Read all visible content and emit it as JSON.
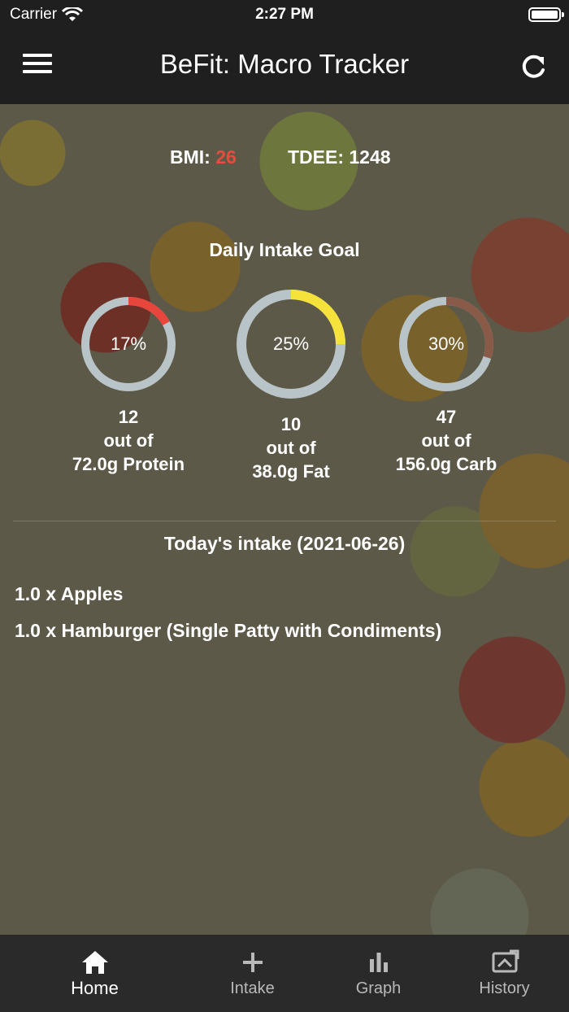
{
  "status_bar": {
    "carrier": "Carrier",
    "time": "2:27 PM"
  },
  "nav": {
    "title": "BeFit: Macro Tracker",
    "menu_icon": "hamburger-menu-icon",
    "refresh_icon": "refresh-icon"
  },
  "stats": {
    "bmi_label": "BMI:",
    "bmi_value": "26",
    "tdee_label": "TDEE: 1248",
    "bmi_color": "#e74c3c"
  },
  "goal": {
    "title": "Daily Intake Goal",
    "rings": [
      {
        "percent_text": "17%",
        "fraction": 0.17,
        "color": "#e8453c",
        "consumed": "12",
        "out_of": "out of",
        "target": "72.0g Protein"
      },
      {
        "percent_text": "25%",
        "fraction": 0.25,
        "color": "#f5e23a",
        "consumed": "10",
        "out_of": "out of",
        "target": "38.0g Fat"
      },
      {
        "percent_text": "30%",
        "fraction": 0.3,
        "color": "#8a5a48",
        "consumed": "47",
        "out_of": "out of",
        "target": "156.0g Carb"
      }
    ],
    "track_color": "#b8c4c8"
  },
  "intake": {
    "title": "Today's intake (2021-06-26)",
    "items": [
      "1.0 x Apples",
      "1.0 x Hamburger (Single Patty with Condiments)"
    ]
  },
  "tabbar": {
    "tabs": [
      {
        "label": "Home",
        "icon": "home-icon",
        "active": true
      },
      {
        "label": "Intake",
        "icon": "plus-icon",
        "active": false
      },
      {
        "label": "Graph",
        "icon": "bar-chart-icon",
        "active": false
      },
      {
        "label": "History",
        "icon": "history-icon",
        "active": false
      }
    ]
  }
}
